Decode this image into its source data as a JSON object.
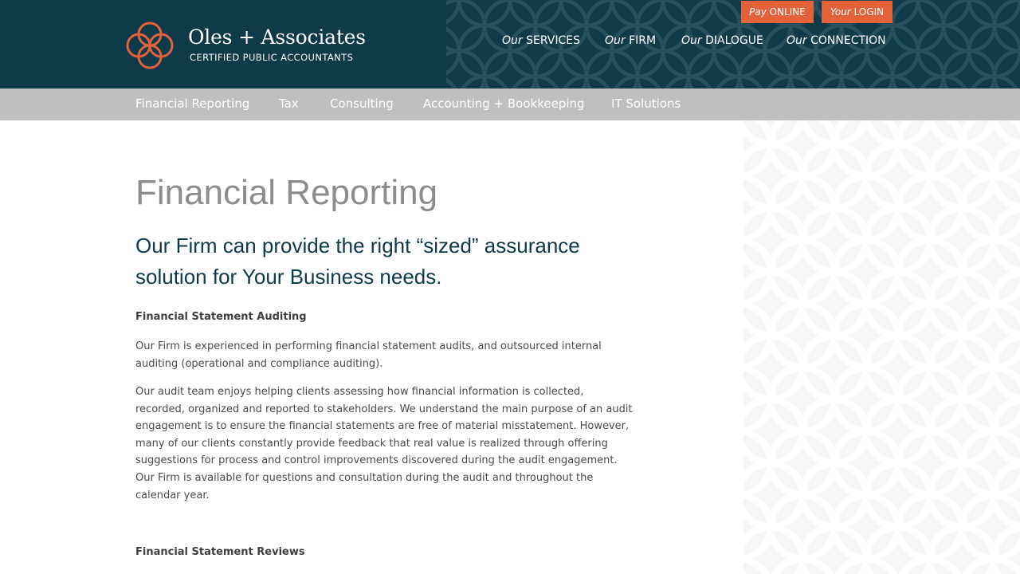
{
  "brand": {
    "name": "Oles + Associates",
    "tagline": "CERTIFIED PUBLIC ACCOUNTANTS",
    "logo_icon": "interlocking-rings-logo-icon",
    "accent_color": "#e3623a",
    "header_color": "#0e3a4a"
  },
  "top_buttons": {
    "pay": {
      "prefix": "Pay",
      "label": "ONLINE"
    },
    "login": {
      "prefix": "Your",
      "label": "LOGIN"
    }
  },
  "main_nav": [
    {
      "prefix": "Our",
      "label": "SERVICES"
    },
    {
      "prefix": "Our",
      "label": "FIRM"
    },
    {
      "prefix": "Our",
      "label": "DIALOGUE"
    },
    {
      "prefix": "Our",
      "label": "CONNECTION"
    }
  ],
  "sub_nav": [
    {
      "label": "Financial Reporting"
    },
    {
      "label": "Tax"
    },
    {
      "label": "Consulting"
    },
    {
      "label": "Accounting + Bookkeeping"
    },
    {
      "label": "IT Solutions"
    }
  ],
  "content": {
    "title": "Financial Reporting",
    "lead": "Our Firm can provide the right “sized” assurance solution for Your Business needs.",
    "sections": [
      {
        "heading": "Financial Statement Auditing",
        "paragraphs": [
          "Our Firm is experienced in performing financial statement audits, and outsourced internal auditing (operational and compliance auditing).",
          "Our audit team enjoys helping clients assessing how financial information is collected, recorded, organized and reported to stakeholders.  We understand the main purpose of an audit engagement is to ensure the financial statements are free of material misstatement.  However, many of our clients constantly provide feedback that real value is realized through offering suggestions for process and control improvements discovered during the audit engagement.  Our Firm is available for questions and consultation during the audit and throughout the calendar year."
        ]
      },
      {
        "heading": "Financial Statement Reviews",
        "paragraphs": []
      }
    ]
  }
}
